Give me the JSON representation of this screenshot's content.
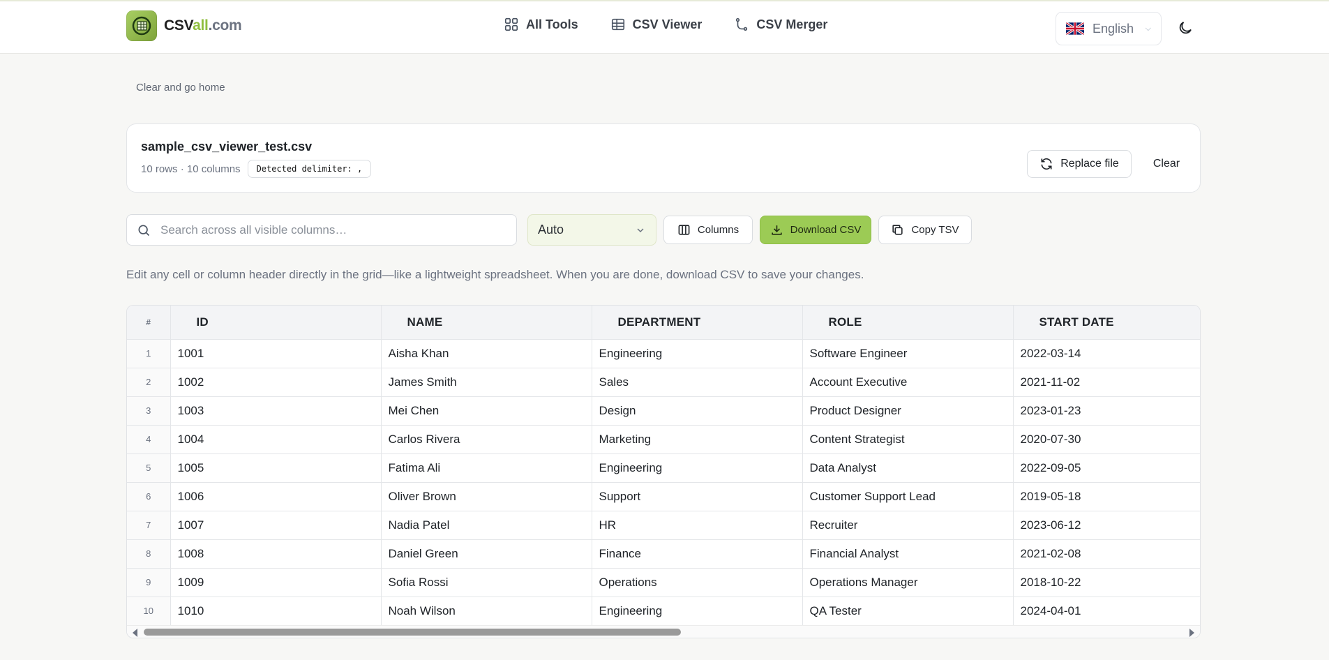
{
  "header": {
    "logo": {
      "part1": "CSV",
      "part2": "all",
      "part3": ".com"
    },
    "nav": [
      {
        "label": "All Tools",
        "icon": "grid-icon"
      },
      {
        "label": "CSV Viewer",
        "icon": "table-icon"
      },
      {
        "label": "CSV Merger",
        "icon": "merge-icon"
      }
    ],
    "language": {
      "label": "English",
      "flag": "uk-flag-icon"
    },
    "theme_icon": "moon-icon"
  },
  "home_link": "Clear and go home",
  "file": {
    "name": "sample_csv_viewer_test.csv",
    "meta": "10 rows · 10 columns",
    "delimiter": "Detected delimiter: ,",
    "replace_label": "Replace file",
    "clear_label": "Clear"
  },
  "toolbar": {
    "search_placeholder": "Search across all visible columns…",
    "delimiter_select": "Auto",
    "columns_label": "Columns",
    "download_label": "Download CSV",
    "copy_label": "Copy TSV"
  },
  "hint": "Edit any cell or column header directly in the grid—like a lightweight spreadsheet. When you are done, download CSV to save your changes.",
  "colors": {
    "accent": "#9ccb55",
    "accent_logo": "#8fbe3f",
    "background": "#f7f7f5"
  },
  "table": {
    "index_header": "#",
    "headers": [
      "ID",
      "NAME",
      "DEPARTMENT",
      "ROLE",
      "START DATE"
    ],
    "rows": [
      {
        "idx": "1",
        "cells": [
          "1001",
          "Aisha Khan",
          "Engineering",
          "Software Engineer",
          "2022-03-14"
        ]
      },
      {
        "idx": "2",
        "cells": [
          "1002",
          "James Smith",
          "Sales",
          "Account Executive",
          "2021-11-02"
        ]
      },
      {
        "idx": "3",
        "cells": [
          "1003",
          "Mei Chen",
          "Design",
          "Product Designer",
          "2023-01-23"
        ]
      },
      {
        "idx": "4",
        "cells": [
          "1004",
          "Carlos Rivera",
          "Marketing",
          "Content Strategist",
          "2020-07-30"
        ]
      },
      {
        "idx": "5",
        "cells": [
          "1005",
          "Fatima Ali",
          "Engineering",
          "Data Analyst",
          "2022-09-05"
        ]
      },
      {
        "idx": "6",
        "cells": [
          "1006",
          "Oliver Brown",
          "Support",
          "Customer Support Lead",
          "2019-05-18"
        ]
      },
      {
        "idx": "7",
        "cells": [
          "1007",
          "Nadia Patel",
          "HR",
          "Recruiter",
          "2023-06-12"
        ]
      },
      {
        "idx": "8",
        "cells": [
          "1008",
          "Daniel Green",
          "Finance",
          "Financial Analyst",
          "2021-02-08"
        ]
      },
      {
        "idx": "9",
        "cells": [
          "1009",
          "Sofia Rossi",
          "Operations",
          "Operations Manager",
          "2018-10-22"
        ]
      },
      {
        "idx": "10",
        "cells": [
          "1010",
          "Noah Wilson",
          "Engineering",
          "QA Tester",
          "2024-04-01"
        ]
      }
    ]
  }
}
